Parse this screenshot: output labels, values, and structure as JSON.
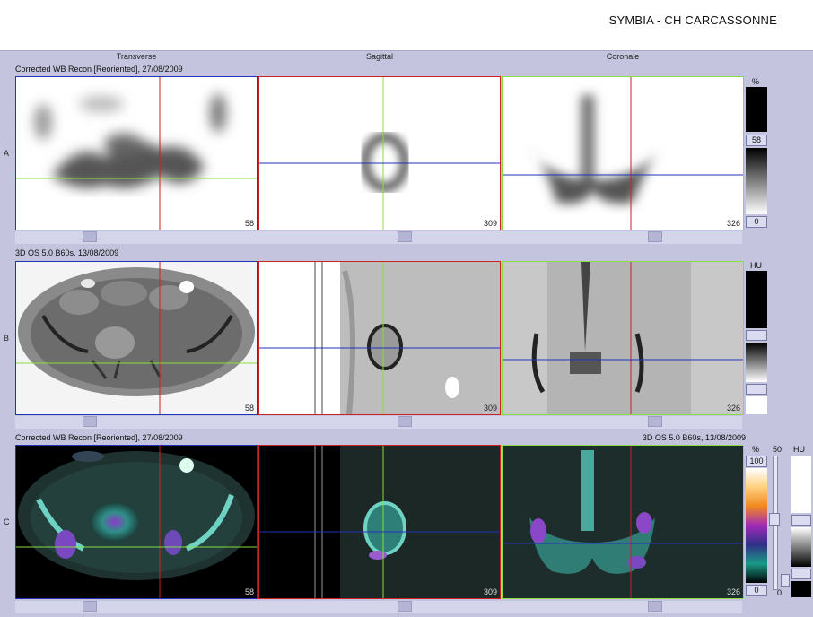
{
  "header": {
    "title": "SYMBIA - CH CARCASSONNE"
  },
  "columns": [
    "Transverse",
    "Sagittal",
    "Coronale"
  ],
  "rows": {
    "a": {
      "label": "A",
      "series": "Corrected WB Recon [Reoriented], 27/08/2009",
      "slices": [
        "58",
        "309",
        "326"
      ],
      "unit": "%",
      "scale_max": "58",
      "scale_min": "0"
    },
    "b": {
      "label": "B",
      "series": "3D  OS  5.0  B60s, 13/08/2009",
      "slices": [
        "58",
        "309",
        "326"
      ],
      "unit": "HU"
    },
    "c": {
      "label": "C",
      "series_left": "Corrected WB Recon [Reoriented], 27/08/2009",
      "series_right": "3D  OS  5.0  B60s, 13/08/2009",
      "slices": [
        "58",
        "309",
        "326"
      ],
      "unit_pet": "%",
      "unit_ct": "HU",
      "fusion_value": "50",
      "pet_max": "100",
      "pet_min": "0",
      "fusion_min": "0"
    }
  },
  "colors": {
    "background": "#c4c4de",
    "red_crosshair": "#cc2222",
    "green_crosshair": "#88dd44",
    "blue_crosshair": "#2233bb"
  }
}
